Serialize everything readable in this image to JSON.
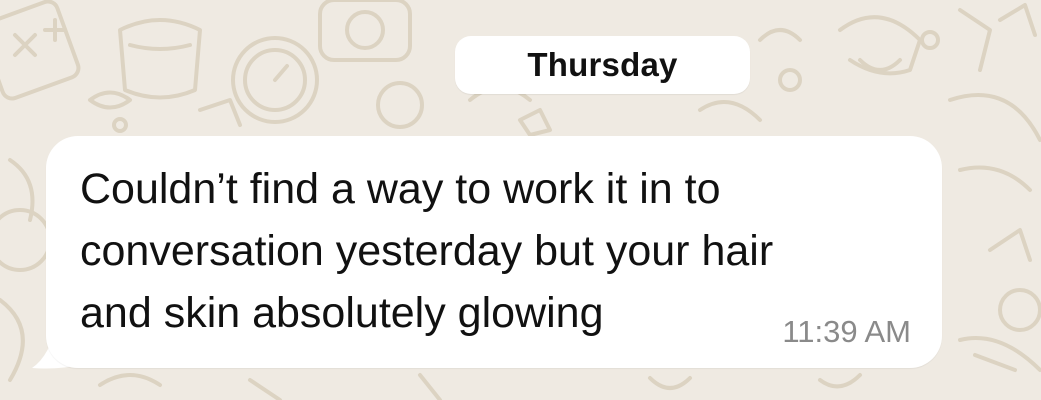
{
  "chat": {
    "date_separator": "Thursday",
    "message": {
      "text": "Couldn’t find a way to work it in to\nconversation yesterday but your hair\nand skin absolutely glowing",
      "time": "11:39 AM",
      "direction": "incoming"
    }
  },
  "colors": {
    "wallpaper": "#efeae2",
    "wallpaper_doodle": "#dcd3c2",
    "bubble": "#ffffff",
    "text": "#111111",
    "timestamp": "#8a8a8a"
  },
  "icons": {
    "wallpaper": "doodle-pattern"
  }
}
